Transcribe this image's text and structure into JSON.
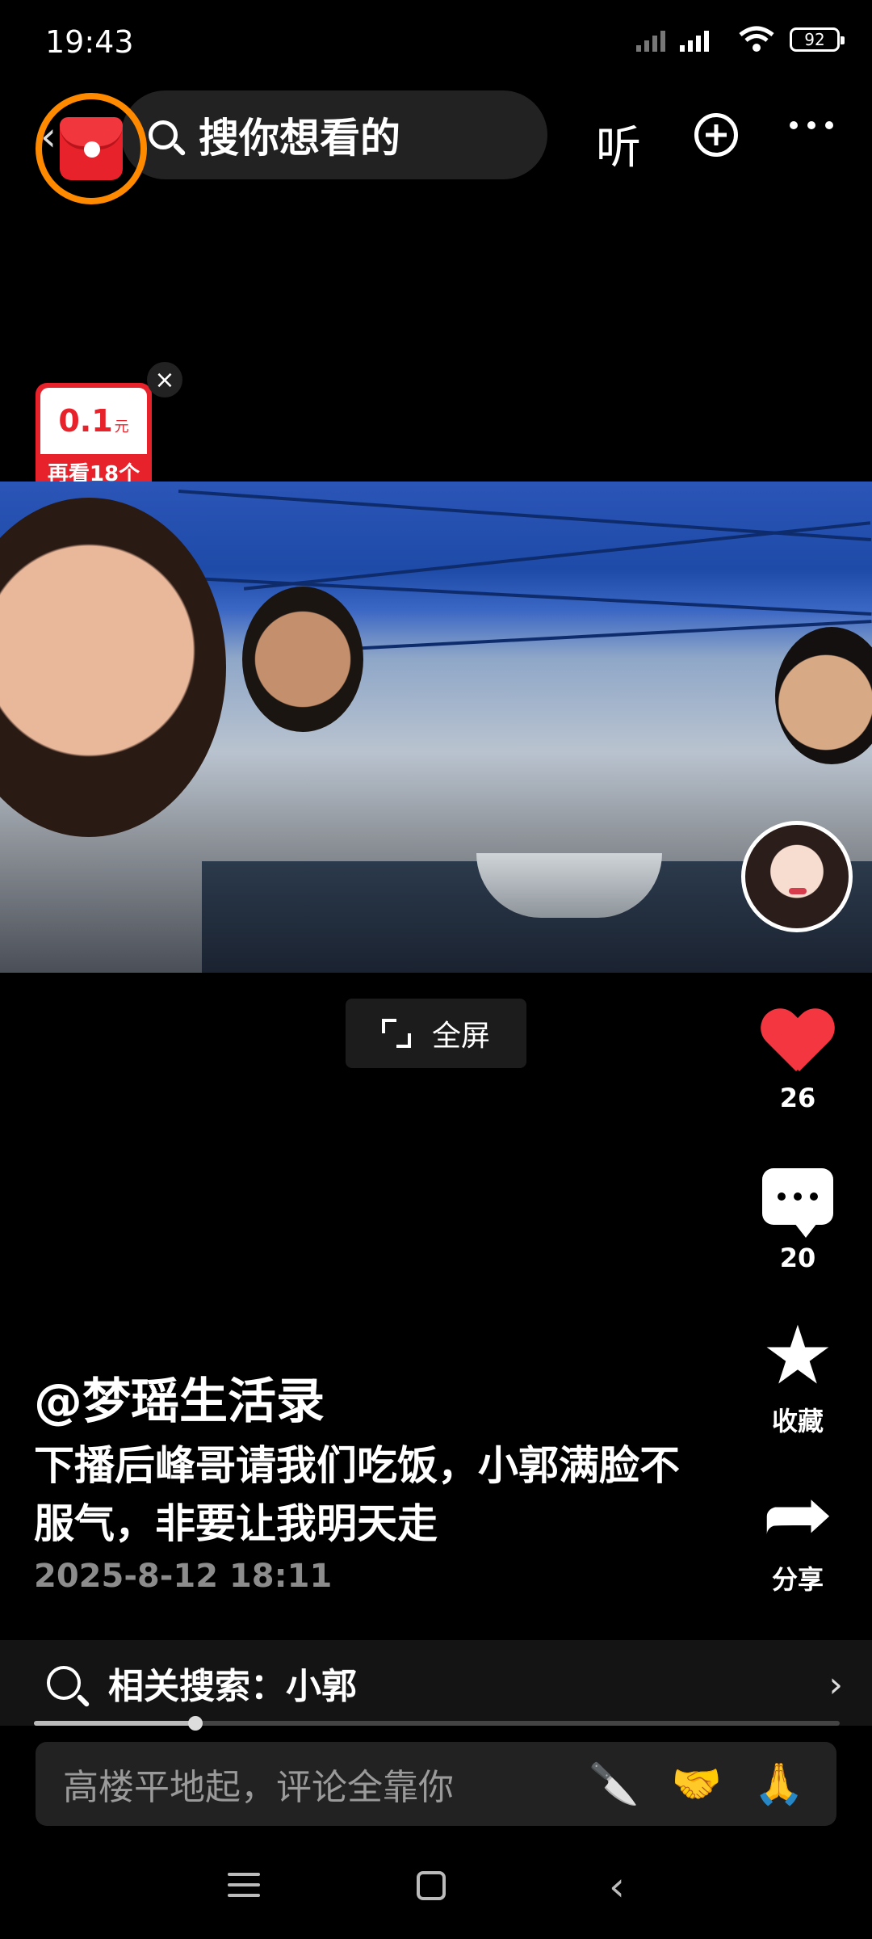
{
  "status_bar": {
    "time": "19:43",
    "battery": "92"
  },
  "top_bar": {
    "search_placeholder": "搜你想看的",
    "listen_label": "听"
  },
  "reward": {
    "amount": "0.1",
    "unit": "元",
    "text": "再看18个",
    "close": "×"
  },
  "video": {
    "fullscreen_label": "全屏"
  },
  "actions": {
    "like_count": "26",
    "comment_count": "20",
    "collect_label": "收藏",
    "share_label": "分享"
  },
  "post": {
    "author": "@梦瑶生活录",
    "description": "下播后峰哥请我们吃饭，小郭满脸不服气，非要让我明天走",
    "date": "2025-8-12 18:11"
  },
  "related_search": {
    "label": "相关搜索：小郭"
  },
  "progress": {
    "fraction": 0.2
  },
  "comment_input": {
    "placeholder": "高楼平地起，评论全靠你",
    "emojis": [
      "🔪",
      "🤝",
      "🙏"
    ]
  }
}
